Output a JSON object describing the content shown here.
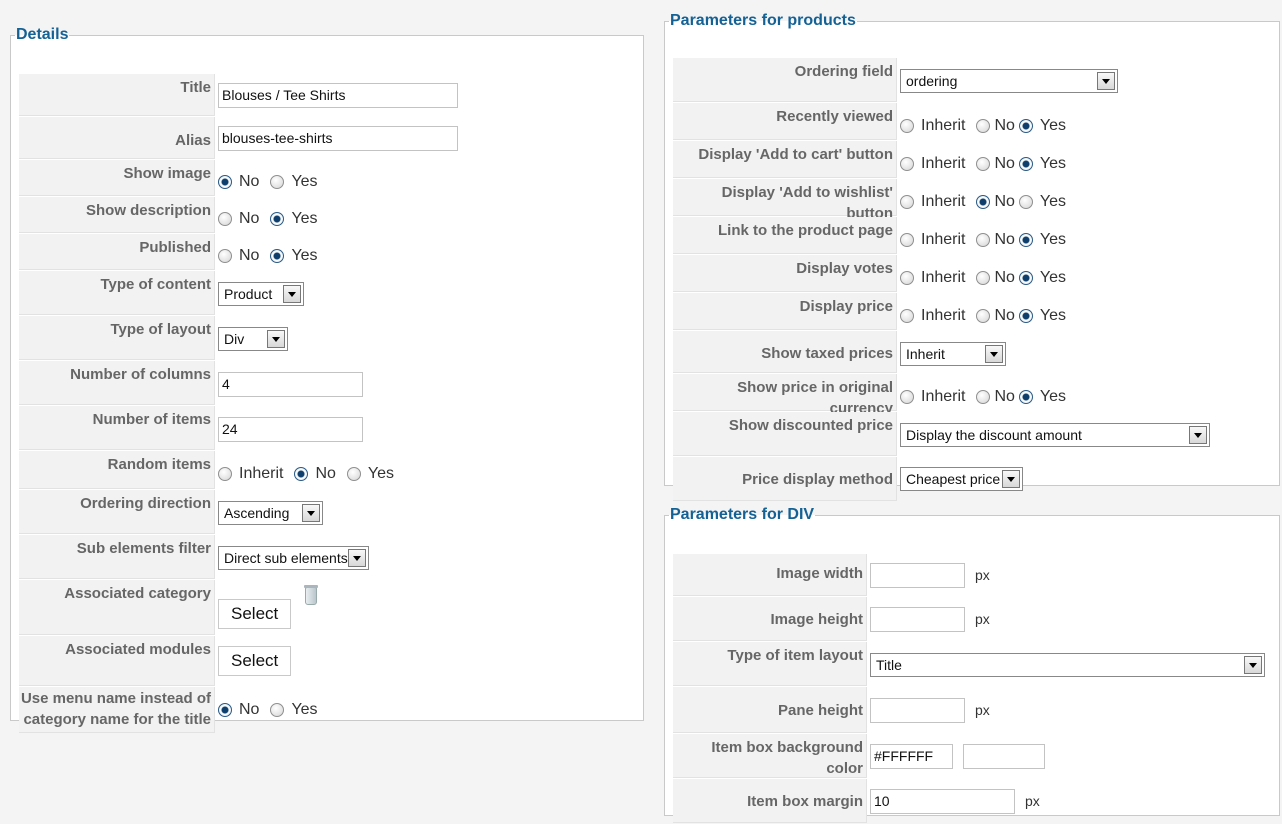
{
  "details": {
    "legend": "Details",
    "title": {
      "label": "Title",
      "value": "Blouses / Tee Shirts"
    },
    "alias": {
      "label": "Alias",
      "value": "blouses-tee-shirts"
    },
    "show_image": {
      "label": "Show image",
      "options": [
        "No",
        "Yes"
      ],
      "selected": "No"
    },
    "show_description": {
      "label": "Show description",
      "options": [
        "No",
        "Yes"
      ],
      "selected": "Yes"
    },
    "published": {
      "label": "Published",
      "options": [
        "No",
        "Yes"
      ],
      "selected": "Yes"
    },
    "type_of_content": {
      "label": "Type of content",
      "value": "Product"
    },
    "type_of_layout": {
      "label": "Type of layout",
      "value": "Div"
    },
    "number_of_columns": {
      "label": "Number of columns",
      "value": "4"
    },
    "number_of_items": {
      "label": "Number of items",
      "value": "24"
    },
    "random_items": {
      "label": "Random items",
      "options": [
        "Inherit",
        "No",
        "Yes"
      ],
      "selected": "No"
    },
    "ordering_direction": {
      "label": "Ordering direction",
      "value": "Ascending"
    },
    "sub_elements_filter": {
      "label": "Sub elements filter",
      "value": "Direct sub elements"
    },
    "associated_category": {
      "label": "Associated category",
      "button": "Select"
    },
    "associated_modules": {
      "label": "Associated modules",
      "button": "Select"
    },
    "use_menu_name": {
      "label_line1": "Use menu name instead of",
      "label_line2": "category name for the title",
      "options": [
        "No",
        "Yes"
      ],
      "selected": "No"
    }
  },
  "products": {
    "legend": "Parameters for products",
    "ordering_field": {
      "label": "Ordering field",
      "value": "ordering"
    },
    "recently_viewed": {
      "label": "Recently viewed",
      "options": [
        "Inherit",
        "No",
        "Yes"
      ],
      "selected": "Yes"
    },
    "add_to_cart": {
      "label": "Display 'Add to cart' button",
      "options": [
        "Inherit",
        "No",
        "Yes"
      ],
      "selected": "Yes"
    },
    "add_to_wishlist": {
      "label": "Display 'Add to wishlist' button",
      "options": [
        "Inherit",
        "No",
        "Yes"
      ],
      "selected": "No"
    },
    "link_product_page": {
      "label": "Link to the product page",
      "options": [
        "Inherit",
        "No",
        "Yes"
      ],
      "selected": "Yes"
    },
    "display_votes": {
      "label": "Display votes",
      "options": [
        "Inherit",
        "No",
        "Yes"
      ],
      "selected": "Yes"
    },
    "display_price": {
      "label": "Display price",
      "options": [
        "Inherit",
        "No",
        "Yes"
      ],
      "selected": "Yes"
    },
    "show_taxed_prices": {
      "label": "Show taxed prices",
      "value": "Inherit"
    },
    "show_original_currency": {
      "label": "Show price in original currency",
      "options": [
        "Inherit",
        "No",
        "Yes"
      ],
      "selected": "Yes"
    },
    "show_discounted_price": {
      "label": "Show discounted price",
      "value": "Display the discount amount"
    },
    "price_display_method": {
      "label": "Price display method",
      "value": "Cheapest price"
    }
  },
  "div": {
    "legend": "Parameters for DIV",
    "image_width": {
      "label": "Image width",
      "value": "",
      "unit": "px"
    },
    "image_height": {
      "label": "Image height",
      "value": "",
      "unit": "px"
    },
    "type_of_item_layout": {
      "label": "Type of item layout",
      "value": "Title"
    },
    "pane_height": {
      "label": "Pane height",
      "value": "",
      "unit": "px"
    },
    "item_box_bg": {
      "label": "Item box background color",
      "value": "#FFFFFF",
      "swatch_color": "#FFFFFF"
    },
    "item_box_margin": {
      "label": "Item box margin",
      "value": "10",
      "unit": "px"
    }
  },
  "colors": {
    "legend": "#146295",
    "label": "#666666",
    "row_bg": "#f2f2f2",
    "radio_selected": "#0e3e6b"
  }
}
